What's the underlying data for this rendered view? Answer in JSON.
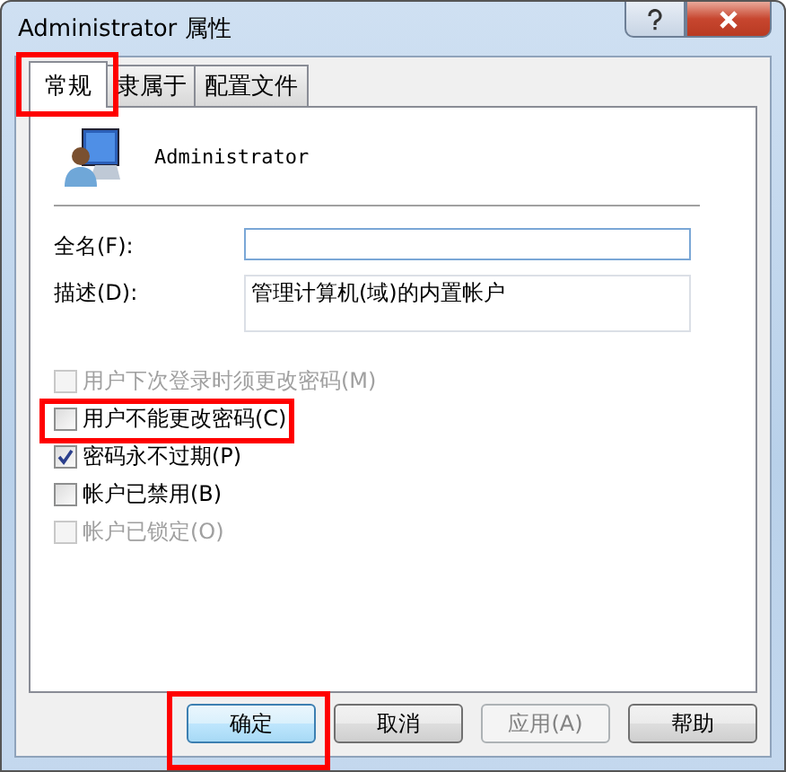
{
  "window": {
    "title": "Administrator 属性"
  },
  "tabs": [
    {
      "label": "常规",
      "selected": true,
      "highlighted": true
    },
    {
      "label": "隶属于",
      "selected": false,
      "highlighted": false
    },
    {
      "label": "配置文件",
      "selected": false,
      "highlighted": false
    }
  ],
  "user": {
    "name": "Administrator"
  },
  "fields": [
    {
      "label": "全名(F):"
    },
    {
      "label": "描述(D):",
      "value": "管理计算机(域)的内置帐户",
      "kind": "multiline"
    }
  ],
  "checkboxes": [
    {
      "label": "用户下次登录时须更改密码(M)",
      "checked": false,
      "disabled": true,
      "highlighted": false
    },
    {
      "label": "用户不能更改密码(C)",
      "checked": false,
      "disabled": false,
      "highlighted": true
    },
    {
      "label": "密码永不过期(P)",
      "checked": true,
      "disabled": false,
      "highlighted": false
    },
    {
      "label": "帐户已禁用(B)",
      "checked": false,
      "disabled": false,
      "highlighted": false
    },
    {
      "label": "帐户已锁定(O)",
      "checked": false,
      "disabled": true,
      "highlighted": false
    }
  ],
  "buttons": [
    {
      "label": "确定",
      "default": true,
      "disabled": false,
      "highlighted": true
    },
    {
      "label": "取消",
      "default": false,
      "disabled": false,
      "highlighted": false
    },
    {
      "label": "应用(A)",
      "default": false,
      "disabled": true,
      "highlighted": false
    },
    {
      "label": "帮助",
      "default": false,
      "disabled": false,
      "highlighted": false
    }
  ]
}
